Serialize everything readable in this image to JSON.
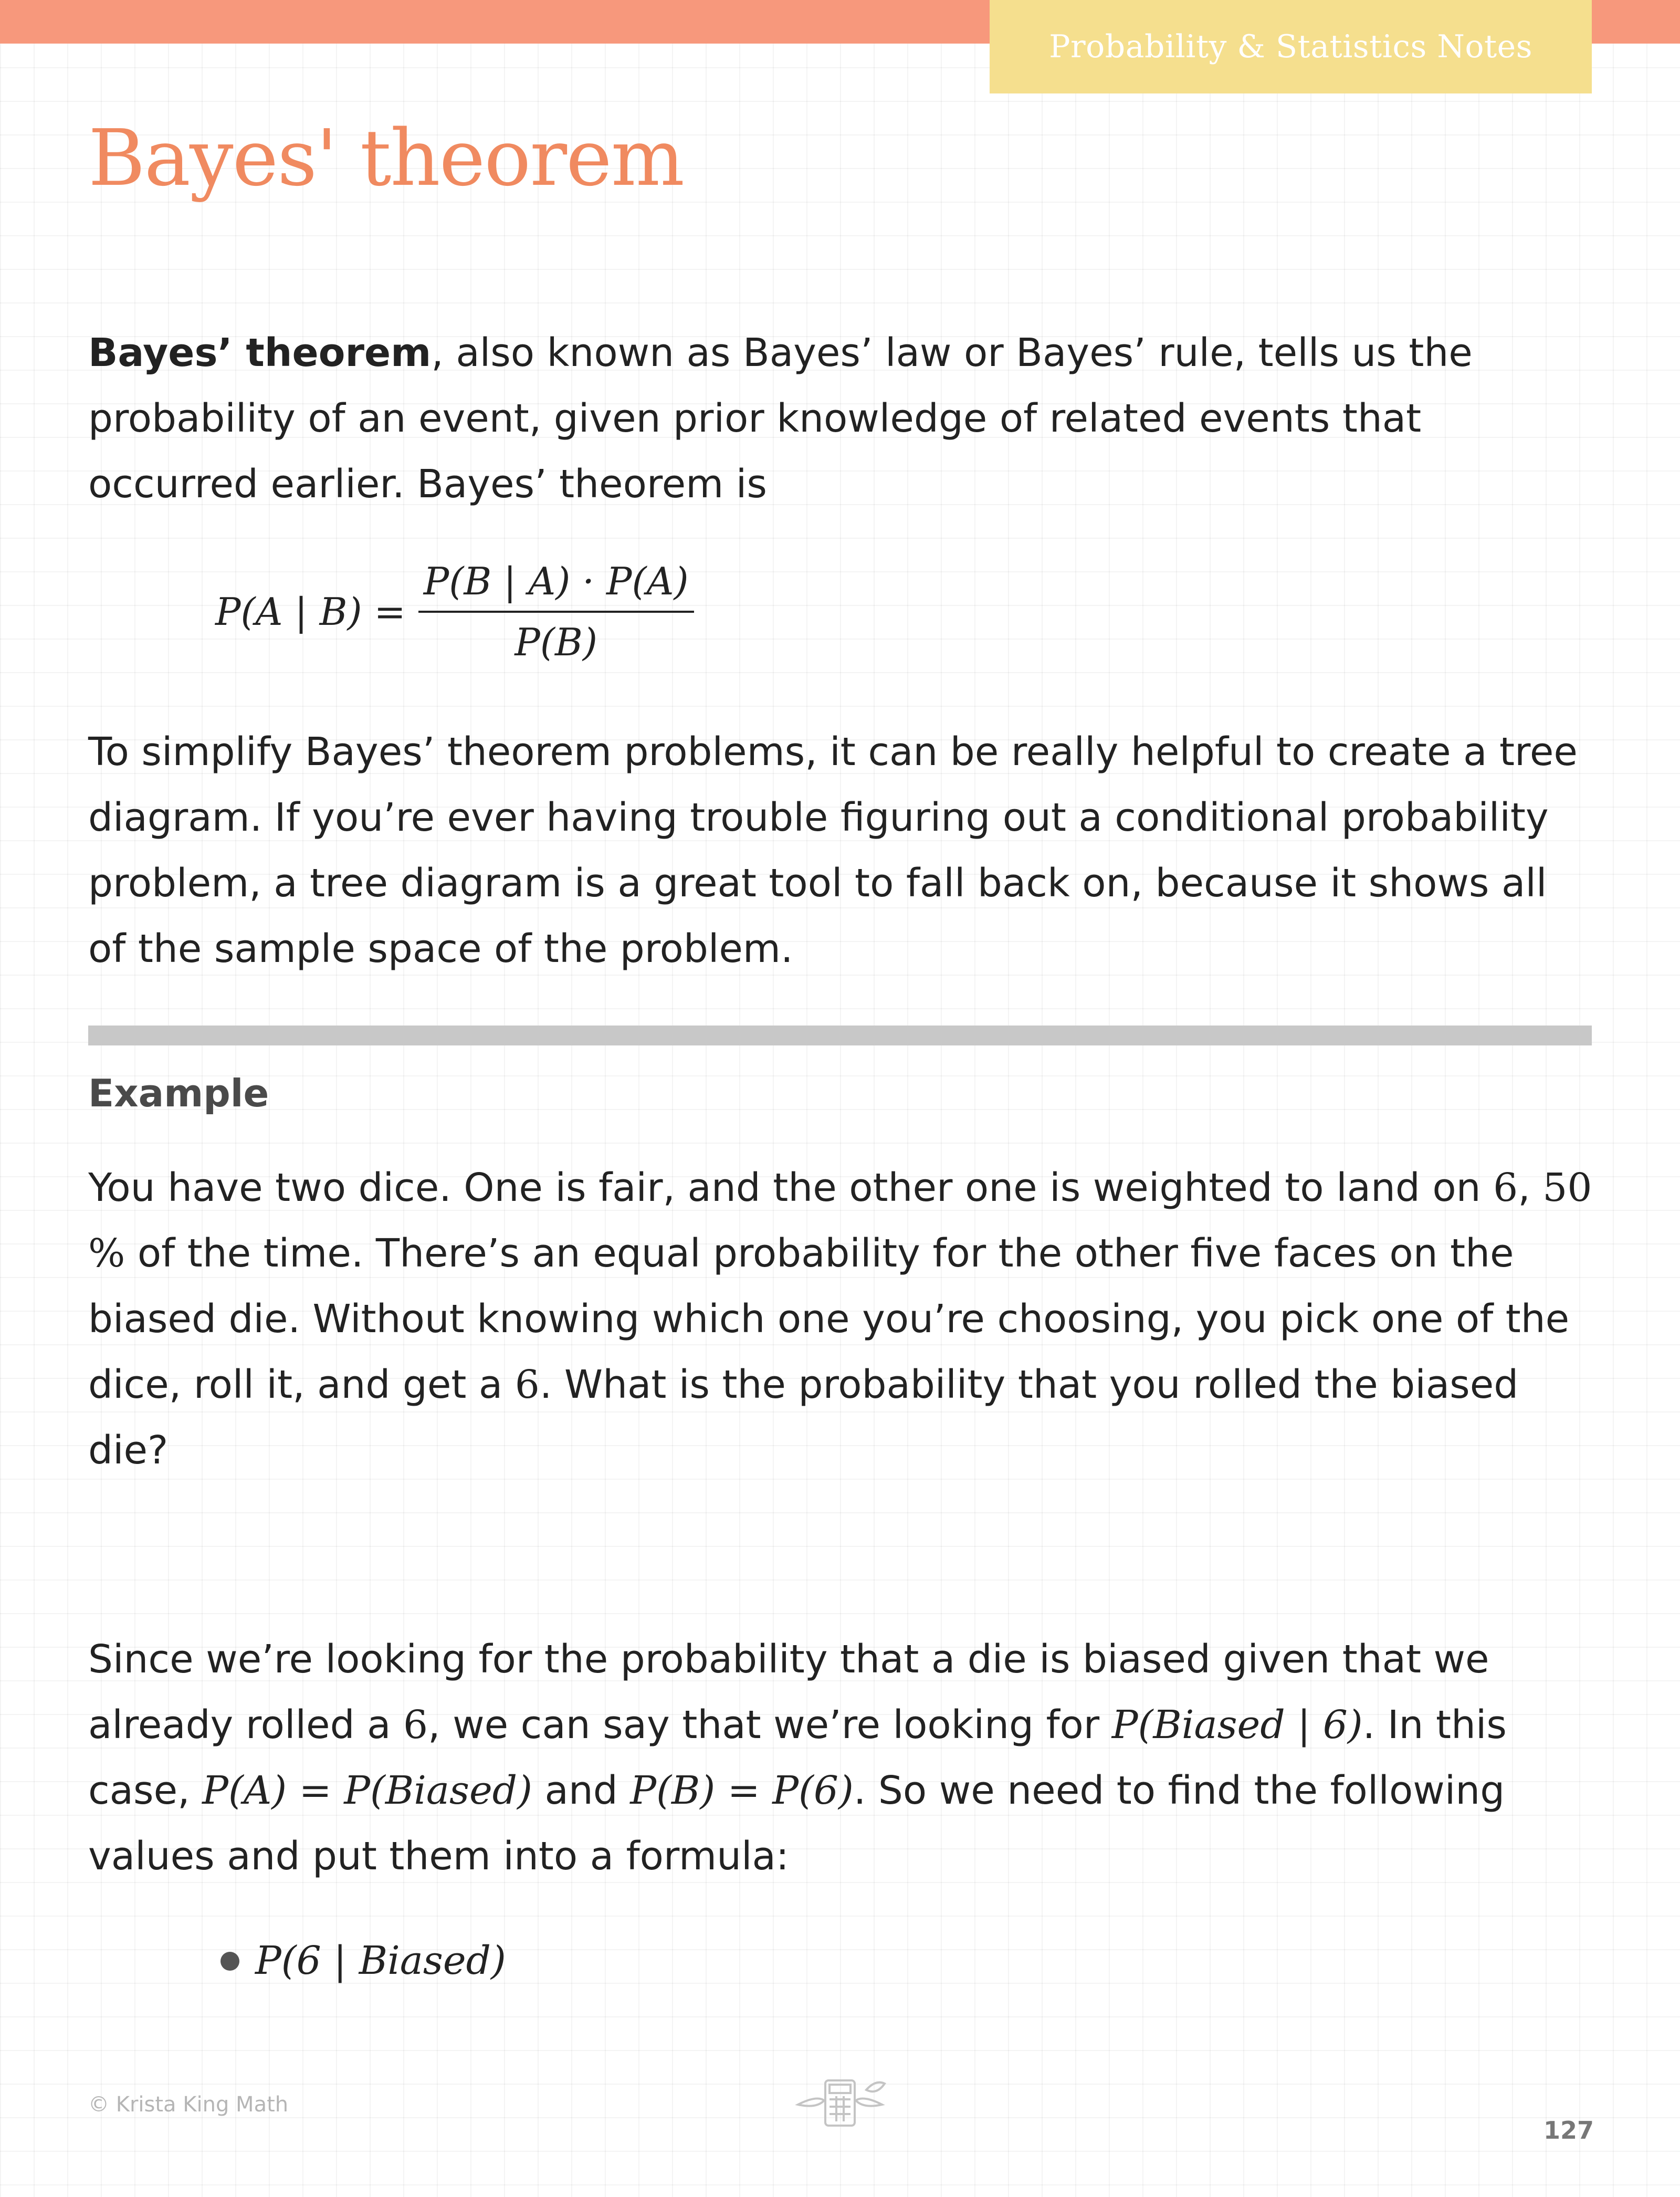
{
  "header": {
    "tab_label": "Probability & Statistics Notes"
  },
  "title": "Bayes' theorem",
  "intro": {
    "bold_term": "Bayes’ theorem",
    "text": ", also known as Bayes’ law or Bayes’ rule, tells us the probability of an event, given prior knowledge of related events that occurred earlier. Bayes’ theorem is"
  },
  "formula": {
    "lhs": "P(A | B) =",
    "numerator": "P(B | A) · P(A)",
    "denominator": "P(B)"
  },
  "tree_paragraph": "To simplify Bayes’ theorem problems, it can be really helpful to create a tree diagram. If you’re ever having trouble figuring out a conditional probability problem, a tree diagram is a great tool to fall back on, because it shows all of the sample space of the problem.",
  "example": {
    "label": "Example",
    "p1": "You have two dice. One is fair, and the other one is weighted to land on ",
    "six": "6",
    "p2": ",",
    "percent": "50 %",
    "p3": " of the time. There’s an equal probability for the other five faces on the biased die. Without knowing which one you’re choosing, you pick one of the dice, roll it, and get a ",
    "p4": ". What is the probability that you rolled the biased die?"
  },
  "solution": {
    "s1": "Since we’re looking for the probability that a die is biased given that we already rolled a ",
    "s2": ", we can say that we’re looking for ",
    "p_biased_given_6": "P(Biased | 6)",
    "s3": ". In this case, ",
    "pa_eq": "P(A) = P(Biased)",
    "and": " and ",
    "pb_eq": "P(B) = P(6)",
    "s4": ". So we need to find the following values and put them into a formula:"
  },
  "bullets": [
    "P(6 | Biased)"
  ],
  "footer": {
    "copyright": "© Krista King Math",
    "page_number": "127",
    "logo_icon": "calculator-icon"
  }
}
